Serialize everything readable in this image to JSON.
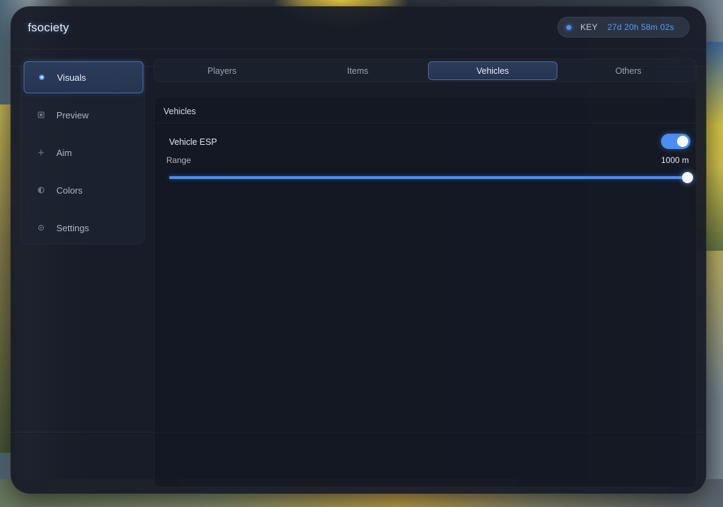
{
  "app": {
    "title": "fsociety"
  },
  "key": {
    "label": "KEY",
    "value": "27d 20h 58m 02s"
  },
  "sidebar": {
    "items": [
      {
        "label": "Visuals",
        "icon": "radio-dot-icon",
        "active": true
      },
      {
        "label": "Preview",
        "icon": "square-icon",
        "active": false
      },
      {
        "label": "Aim",
        "icon": "crosshair-plus-icon",
        "active": false
      },
      {
        "label": "Colors",
        "icon": "half-circle-icon",
        "active": false
      },
      {
        "label": "Settings",
        "icon": "gear-icon",
        "active": false
      }
    ]
  },
  "tabs": [
    {
      "label": "Players",
      "active": false
    },
    {
      "label": "Items",
      "active": false
    },
    {
      "label": "Vehicles",
      "active": true
    },
    {
      "label": "Others",
      "active": false
    }
  ],
  "section": {
    "title": "Vehicles",
    "vehicle_esp": {
      "label": "Vehicle ESP",
      "enabled": true
    },
    "range": {
      "label": "Range",
      "value_text": "1000 m",
      "value": 1000,
      "max": 1000,
      "fraction": 1.0
    }
  },
  "colors": {
    "accent": "#4b8ef2",
    "key_value": "#5a9cf5"
  }
}
